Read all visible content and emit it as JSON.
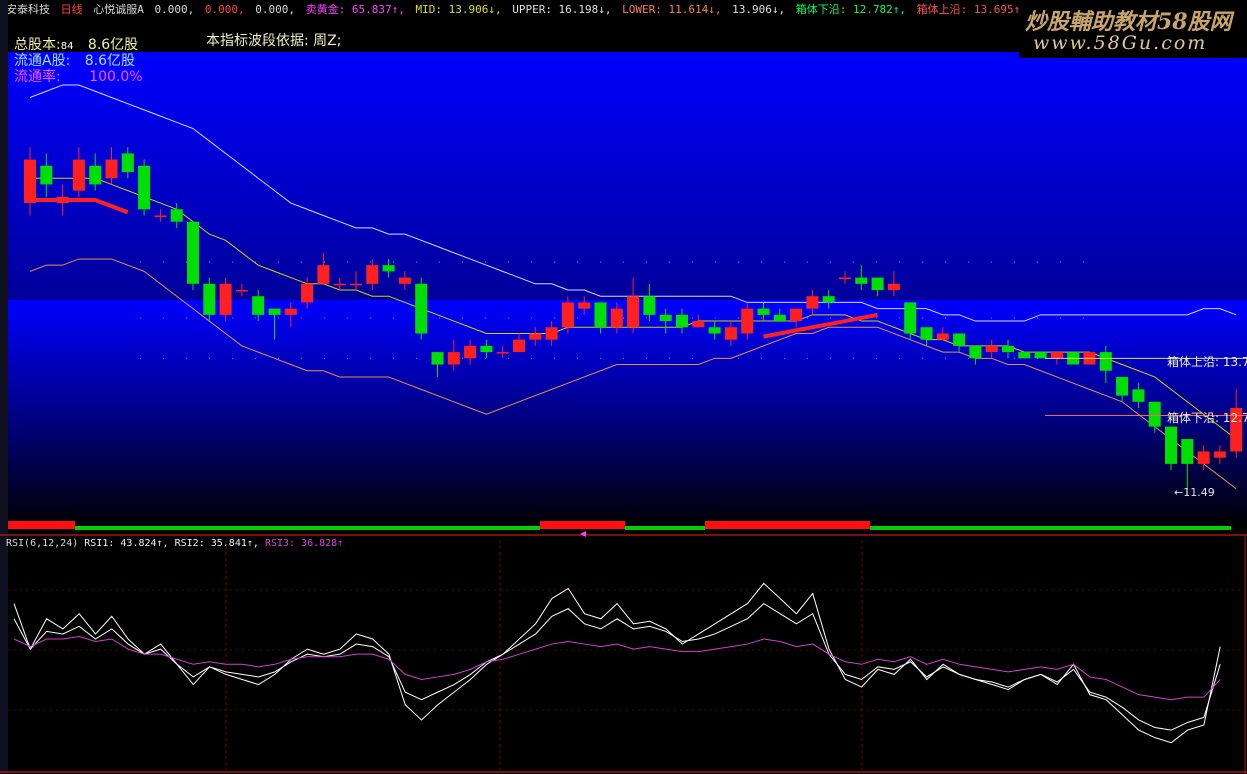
{
  "header": {
    "stock_name": "安泰科技",
    "period": "日线",
    "indicator": "心悦诚服A",
    "v1": "0.000,",
    "v2": "0.000,",
    "v3": "0.000,",
    "sell_gold": "卖黄金: 65.837↑,",
    "mid": "MID: 13.906↓,",
    "upper": "UPPER: 16.198↓,",
    "lower": "LOWER: 11.614↓,",
    "v4": "13.906↓,",
    "box_low": "箱体下沿: 12.782↑,",
    "box_high": "箱体上沿: 13.695↑,"
  },
  "watermark": {
    "line1": "炒股輔助教材58股网",
    "line2": "www.58Gu.com"
  },
  "info": {
    "total_label": "总股本:",
    "total_value": "8.6亿股",
    "badge": "84",
    "float_label": "流通A股:",
    "float_value": "8.6亿股",
    "ratio_label": "流通率:",
    "ratio_value": "100.0%",
    "basis": "本指标波段依据: 周Z;"
  },
  "annotations": {
    "box_high": "箱体上沿: 13.7",
    "box_low": "箱体下沿: 12.7",
    "low_price": "←11.49"
  },
  "rsi": {
    "title": "RSI(6,12,24)",
    "rsi1": "RSI1: 43.824↑,",
    "rsi2": "RSI2: 35.841↑,",
    "rsi3": "RSI3: 36.828↑"
  },
  "colors": {
    "up": "#ff2020",
    "down": "#00e000",
    "upper_band": "#d8d8ff",
    "mid_line": "#d4d400",
    "lower_band": "#e89050",
    "rsi3": "#d040d0"
  },
  "chart_data": {
    "type": "candlestick",
    "series": [
      {
        "name": "K",
        "ohlc": [
          [
            16.2,
            16.9,
            16.0,
            17.1
          ],
          [
            16.8,
            16.5,
            16.3,
            17.0
          ],
          [
            16.2,
            16.3,
            16.0,
            16.5
          ],
          [
            16.4,
            16.9,
            16.3,
            17.1
          ],
          [
            16.8,
            16.5,
            16.4,
            17.0
          ],
          [
            16.6,
            16.9,
            16.5,
            17.1
          ],
          [
            17.0,
            16.7,
            16.6,
            17.1
          ],
          [
            16.8,
            16.1,
            16.0,
            16.9
          ],
          [
            16.0,
            16.0,
            15.9,
            16.1
          ],
          [
            16.1,
            15.9,
            15.8,
            16.2
          ],
          [
            15.9,
            14.9,
            14.8,
            15.9
          ],
          [
            14.9,
            14.4,
            14.3,
            15.0
          ],
          [
            14.4,
            14.9,
            14.3,
            15.0
          ],
          [
            14.8,
            14.8,
            14.7,
            14.9
          ],
          [
            14.7,
            14.4,
            14.3,
            14.8
          ],
          [
            14.5,
            14.4,
            14.0,
            14.5
          ],
          [
            14.4,
            14.5,
            14.2,
            14.6
          ],
          [
            14.6,
            14.9,
            14.5,
            15.0
          ],
          [
            14.9,
            15.2,
            14.9,
            15.4
          ],
          [
            14.9,
            14.9,
            14.8,
            15.0
          ],
          [
            14.9,
            14.9,
            14.8,
            15.1
          ],
          [
            14.9,
            15.2,
            14.8,
            15.3
          ],
          [
            15.2,
            15.1,
            15.0,
            15.3
          ],
          [
            14.9,
            15.0,
            14.8,
            15.1
          ],
          [
            14.9,
            14.1,
            14.0,
            15.0
          ],
          [
            13.8,
            13.6,
            13.4,
            13.8
          ],
          [
            13.6,
            13.8,
            13.5,
            14.0
          ],
          [
            13.7,
            13.9,
            13.6,
            14.0
          ],
          [
            13.9,
            13.8,
            13.7,
            14.0
          ],
          [
            13.8,
            13.8,
            13.7,
            13.9
          ],
          [
            13.8,
            14.0,
            13.8,
            14.1
          ],
          [
            14.0,
            14.1,
            13.9,
            14.2
          ],
          [
            14.0,
            14.2,
            13.9,
            14.3
          ],
          [
            14.2,
            14.6,
            14.1,
            14.7
          ],
          [
            14.5,
            14.6,
            14.4,
            14.7
          ],
          [
            14.6,
            14.2,
            14.1,
            14.6
          ],
          [
            14.2,
            14.5,
            14.1,
            14.6
          ],
          [
            14.2,
            14.7,
            14.1,
            15.0
          ],
          [
            14.7,
            14.4,
            14.3,
            14.9
          ],
          [
            14.4,
            14.3,
            14.1,
            14.5
          ],
          [
            14.4,
            14.2,
            14.1,
            14.5
          ],
          [
            14.2,
            14.3,
            14.2,
            14.4
          ],
          [
            14.2,
            14.1,
            14.0,
            14.3
          ],
          [
            14.0,
            14.2,
            13.9,
            14.3
          ],
          [
            14.1,
            14.5,
            14.0,
            14.6
          ],
          [
            14.5,
            14.4,
            14.3,
            14.6
          ],
          [
            14.4,
            14.3,
            14.3,
            14.5
          ],
          [
            14.3,
            14.5,
            14.2,
            14.5
          ],
          [
            14.5,
            14.7,
            14.4,
            14.8
          ],
          [
            14.7,
            14.6,
            14.5,
            14.8
          ],
          [
            15.0,
            15.0,
            14.9,
            15.1
          ],
          [
            15.0,
            14.9,
            14.8,
            15.2
          ],
          [
            15.0,
            14.8,
            14.7,
            15.0
          ],
          [
            14.8,
            14.9,
            14.7,
            15.1
          ],
          [
            14.6,
            14.1,
            14.0,
            14.6
          ],
          [
            14.2,
            14.0,
            13.9,
            14.2
          ],
          [
            14.0,
            14.1,
            14.0,
            14.2
          ],
          [
            14.1,
            13.9,
            13.8,
            14.1
          ],
          [
            13.9,
            13.7,
            13.6,
            13.9
          ],
          [
            13.8,
            13.9,
            13.7,
            14.0
          ],
          [
            13.9,
            13.8,
            13.7,
            14.0
          ],
          [
            13.8,
            13.7,
            13.7,
            13.8
          ],
          [
            13.8,
            13.7,
            13.7,
            13.8
          ],
          [
            13.7,
            13.8,
            13.6,
            13.8
          ],
          [
            13.8,
            13.6,
            13.6,
            13.8
          ],
          [
            13.6,
            13.8,
            13.6,
            13.8
          ],
          [
            13.8,
            13.5,
            13.3,
            13.9
          ],
          [
            13.4,
            13.1,
            13.0,
            13.4
          ],
          [
            13.2,
            13.0,
            12.9,
            13.3
          ],
          [
            13.0,
            12.6,
            12.5,
            13.0
          ],
          [
            12.6,
            12.0,
            11.9,
            12.6
          ],
          [
            12.4,
            12.0,
            11.5,
            12.4
          ],
          [
            12.0,
            12.2,
            11.9,
            12.3
          ],
          [
            12.1,
            12.2,
            12.0,
            12.3
          ],
          [
            12.2,
            12.9,
            12.1,
            13.2
          ]
        ]
      },
      {
        "name": "UPPER",
        "values": [
          17.9,
          18.0,
          18.1,
          18.1,
          18.0,
          17.9,
          17.8,
          17.7,
          17.6,
          17.5,
          17.4,
          17.2,
          17.0,
          16.8,
          16.6,
          16.4,
          16.2,
          16.1,
          16.0,
          15.9,
          15.8,
          15.8,
          15.7,
          15.7,
          15.6,
          15.5,
          15.4,
          15.3,
          15.2,
          15.1,
          15.0,
          14.9,
          14.9,
          14.8,
          14.8,
          14.7,
          14.7,
          14.7,
          14.7,
          14.7,
          14.7,
          14.7,
          14.7,
          14.7,
          14.6,
          14.6,
          14.6,
          14.6,
          14.6,
          14.6,
          14.6,
          14.6,
          14.5,
          14.5,
          14.5,
          14.5,
          14.4,
          14.4,
          14.3,
          14.3,
          14.3,
          14.3,
          14.4,
          14.4,
          14.4,
          14.4,
          14.4,
          14.4,
          14.4,
          14.4,
          14.4,
          14.4,
          14.5,
          14.5,
          14.4
        ]
      },
      {
        "name": "MID",
        "values": [
          16.6,
          16.6,
          16.6,
          16.6,
          16.6,
          16.5,
          16.4,
          16.3,
          16.2,
          16.1,
          15.9,
          15.7,
          15.6,
          15.4,
          15.2,
          15.1,
          15.0,
          14.9,
          14.9,
          14.8,
          14.8,
          14.7,
          14.7,
          14.6,
          14.5,
          14.4,
          14.3,
          14.2,
          14.1,
          14.1,
          14.1,
          14.1,
          14.1,
          14.2,
          14.2,
          14.2,
          14.2,
          14.2,
          14.2,
          14.2,
          14.2,
          14.3,
          14.3,
          14.3,
          14.3,
          14.3,
          14.3,
          14.3,
          14.4,
          14.4,
          14.4,
          14.3,
          14.3,
          14.2,
          14.1,
          14.0,
          14.0,
          13.9,
          13.9,
          13.9,
          13.9,
          13.8,
          13.8,
          13.8,
          13.8,
          13.8,
          13.7,
          13.6,
          13.5,
          13.4,
          13.2,
          13.0,
          12.8,
          12.6,
          12.4
        ]
      },
      {
        "name": "LOWER",
        "values": [
          15.1,
          15.2,
          15.2,
          15.3,
          15.3,
          15.3,
          15.2,
          15.1,
          14.9,
          14.7,
          14.5,
          14.3,
          14.1,
          13.9,
          13.8,
          13.7,
          13.6,
          13.5,
          13.5,
          13.4,
          13.4,
          13.4,
          13.4,
          13.3,
          13.2,
          13.1,
          13.0,
          12.9,
          12.8,
          12.9,
          13.0,
          13.1,
          13.2,
          13.3,
          13.4,
          13.5,
          13.6,
          13.6,
          13.6,
          13.6,
          13.6,
          13.6,
          13.7,
          13.7,
          13.8,
          13.9,
          14.0,
          14.1,
          14.1,
          14.2,
          14.2,
          14.2,
          14.2,
          14.1,
          14.0,
          13.9,
          13.8,
          13.8,
          13.7,
          13.7,
          13.6,
          13.6,
          13.5,
          13.4,
          13.3,
          13.2,
          13.1,
          13.0,
          12.8,
          12.6,
          12.4,
          12.2,
          12.0,
          11.8,
          11.6
        ]
      },
      {
        "name": "RSI1",
        "values": [
          80,
          62,
          74,
          70,
          76,
          68,
          75,
          66,
          60,
          64,
          56,
          48,
          55,
          52,
          50,
          48,
          52,
          58,
          62,
          60,
          62,
          68,
          66,
          60,
          40,
          34,
          40,
          45,
          50,
          56,
          60,
          66,
          72,
          82,
          86,
          76,
          74,
          80,
          72,
          73,
          70,
          64,
          68,
          72,
          76,
          80,
          88,
          82,
          76,
          84,
          62,
          50,
          47,
          54,
          52,
          58,
          50,
          56,
          52,
          50,
          48,
          46,
          50,
          52,
          48,
          56,
          44,
          42,
          36,
          30,
          27,
          25,
          30,
          32,
          63
        ]
      },
      {
        "name": "RSI2",
        "values": [
          74,
          62,
          69,
          68,
          71,
          66,
          70,
          64,
          60,
          62,
          56,
          51,
          55,
          53,
          52,
          51,
          53,
          57,
          60,
          59,
          60,
          64,
          63,
          59,
          45,
          42,
          45,
          48,
          52,
          57,
          60,
          64,
          68,
          75,
          78,
          72,
          70,
          74,
          70,
          71,
          69,
          65,
          66,
          68,
          71,
          74,
          80,
          76,
          72,
          76,
          60,
          52,
          50,
          55,
          54,
          57,
          51,
          55,
          52,
          50,
          49,
          47,
          50,
          52,
          49,
          54,
          45,
          43,
          39,
          34,
          31,
          30,
          33,
          35,
          56
        ]
      },
      {
        "name": "RSI3",
        "values": [
          66,
          63,
          66,
          66,
          67,
          65,
          66,
          62,
          60,
          60,
          58,
          56,
          57,
          56,
          56,
          55,
          56,
          58,
          59,
          59,
          59,
          60,
          60,
          58,
          52,
          50,
          51,
          52,
          54,
          57,
          58,
          60,
          62,
          64,
          65,
          64,
          63,
          64,
          62,
          63,
          62,
          61,
          61,
          62,
          63,
          64,
          66,
          65,
          63,
          64,
          60,
          57,
          56,
          58,
          57,
          59,
          56,
          58,
          56,
          55,
          54,
          53,
          54,
          55,
          54,
          56,
          51,
          50,
          47,
          44,
          43,
          42,
          43,
          43,
          50
        ]
      }
    ],
    "ylim": [
      11.0,
      18.6
    ],
    "rsi_ylim": [
      15,
      100
    ],
    "grid": true
  }
}
